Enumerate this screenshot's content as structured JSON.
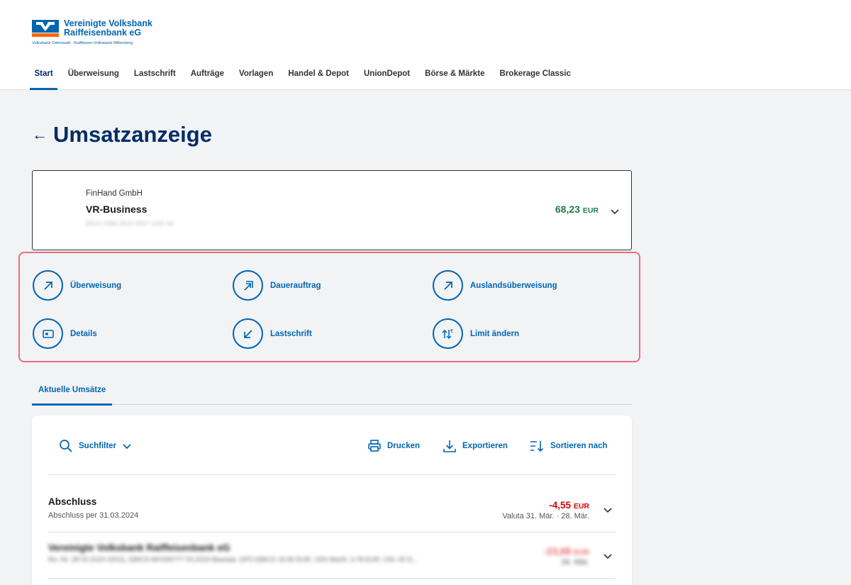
{
  "bank": {
    "name_line1": "Vereinigte Volksbank",
    "name_line2": "Raiffeisenbank eG",
    "sub": "Volksbank Odenwald · Raiffeisen-Volksbank Miltenberg",
    "colors": {
      "brand_blue": "#0066b3",
      "brand_orange": "#ff6600",
      "navy": "#002d67"
    }
  },
  "nav": {
    "items": [
      {
        "label": "Start",
        "active": true
      },
      {
        "label": "Überweisung"
      },
      {
        "label": "Lastschrift"
      },
      {
        "label": "Aufträge"
      },
      {
        "label": "Vorlagen"
      },
      {
        "label": "Handel & Depot"
      },
      {
        "label": "UnionDepot"
      },
      {
        "label": "Börse & Märkte"
      },
      {
        "label": "Brokerage Classic"
      }
    ]
  },
  "page": {
    "back_icon": "arrow-left-icon",
    "title": "Umsatzanzeige"
  },
  "account": {
    "owner": "FinHand GmbH",
    "name": "VR-Business",
    "iban": "DE24 5086 3513 0007 1155 66",
    "balance_value": "68,23",
    "balance_currency": "EUR",
    "balance_color": "#237a4b"
  },
  "actions": [
    {
      "label": "Überweisung",
      "icon": "arrow-up-right-icon"
    },
    {
      "label": "Dauerauftrag",
      "icon": "double-arrow-up-right-icon"
    },
    {
      "label": "Auslandsüberweisung",
      "icon": "arrow-up-right-icon"
    },
    {
      "label": "Details",
      "icon": "card-details-icon"
    },
    {
      "label": "Lastschrift",
      "icon": "arrow-down-left-icon"
    },
    {
      "label": "Limit ändern",
      "icon": "limit-arrows-euro-icon"
    }
  ],
  "tabs": [
    {
      "label": "Aktuelle Umsätze",
      "active": true
    }
  ],
  "toolbar": {
    "search_label": "Suchfilter",
    "print_label": "Drucken",
    "export_label": "Exportieren",
    "sort_label": "Sortieren nach"
  },
  "transactions": [
    {
      "title": "Abschluss",
      "subtitle": "Abschluss per 31.03.2024",
      "amount": "-4,55",
      "currency": "EUR",
      "valuta": "Valuta  31. Mär.  ·  28. Mär.",
      "blurred": false
    },
    {
      "title": "Vereinigte Volksbank Raiffeisenbank eG",
      "subtitle": "Re.-Nr. 28 03 2024 42011, EBICS-MV094777 03.2024 Basistar. DFÜ EBICS 19,90 EUR, 19% MwSt. 3,78 EUR, USt.-ID D...",
      "amount": "-23,68",
      "currency": "EUR",
      "valuta": "26. Mär.",
      "blurred": true
    }
  ],
  "status_colors": {
    "negative": "#d40000",
    "positive": "#237a4b",
    "focus_outline": "#ec6c80"
  }
}
